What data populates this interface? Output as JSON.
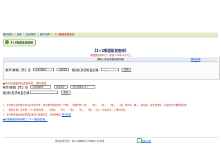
{
  "breadcrumb": {
    "items": [
      "郵局首頁",
      "首頁",
      "查詢專區",
      "郵件資費",
      "3+2郵遞區號查詢"
    ]
  },
  "logo": {
    "text": "3+2郵遞區號查詢"
  },
  "header": {
    "title": "【3+2郵遞區號查詢】",
    "update_note": "郵遞區號資料日：民國 103年10月7日"
  },
  "search_panel": {
    "panel_title": "請輸入欲查詢郵遞區號者",
    "help_link": "操作說明",
    "row1": {
      "label": "縣市/鄉鎮【市】區",
      "city_select": "請選擇縣市",
      "district_select": "請選擇區",
      "road_label": "路(街)及或村里名稱",
      "road_select": "....",
      "query_button": "查詢"
    },
    "warning": "●如不知道路(巷)道路名時，請先查詢",
    "row2": {
      "label": "縣市/鄉鎮【市】區",
      "city_select": "請選擇縣市",
      "district_select": "請選擇區",
      "road_select": "請先選擇區(市)",
      "road_label": "路(街)及或村里名稱",
      "query_button": "查詢"
    }
  },
  "notes": [
    "1、本系統查詢所顯示的內容僅供參考，郵件郵寄時請依照「門牌」，各種門牌「段」、「巷」、「弄」、「號」、「樓」等資料，輸入（或點選）後查詢資料，才能查到正確郵遞區號。",
    "2、「郵遞區號」請依照「3+2郵遞區號」，「區碼」、「段」、「巷」、「弄」、「號」，請以「前後包含」之規則檢索。",
    "3、部分特殊偏遠地區郵遞區號請以郵局為準，如有疑問請",
    "●查詢郵遞區號有關之「3+2郵遞區號」"
  ],
  "notes_link": "電子信箱",
  "footer": {
    "text": "郵遞區號查詢，請以中華郵政公司網站公告為準",
    "link": "回到上頁"
  }
}
